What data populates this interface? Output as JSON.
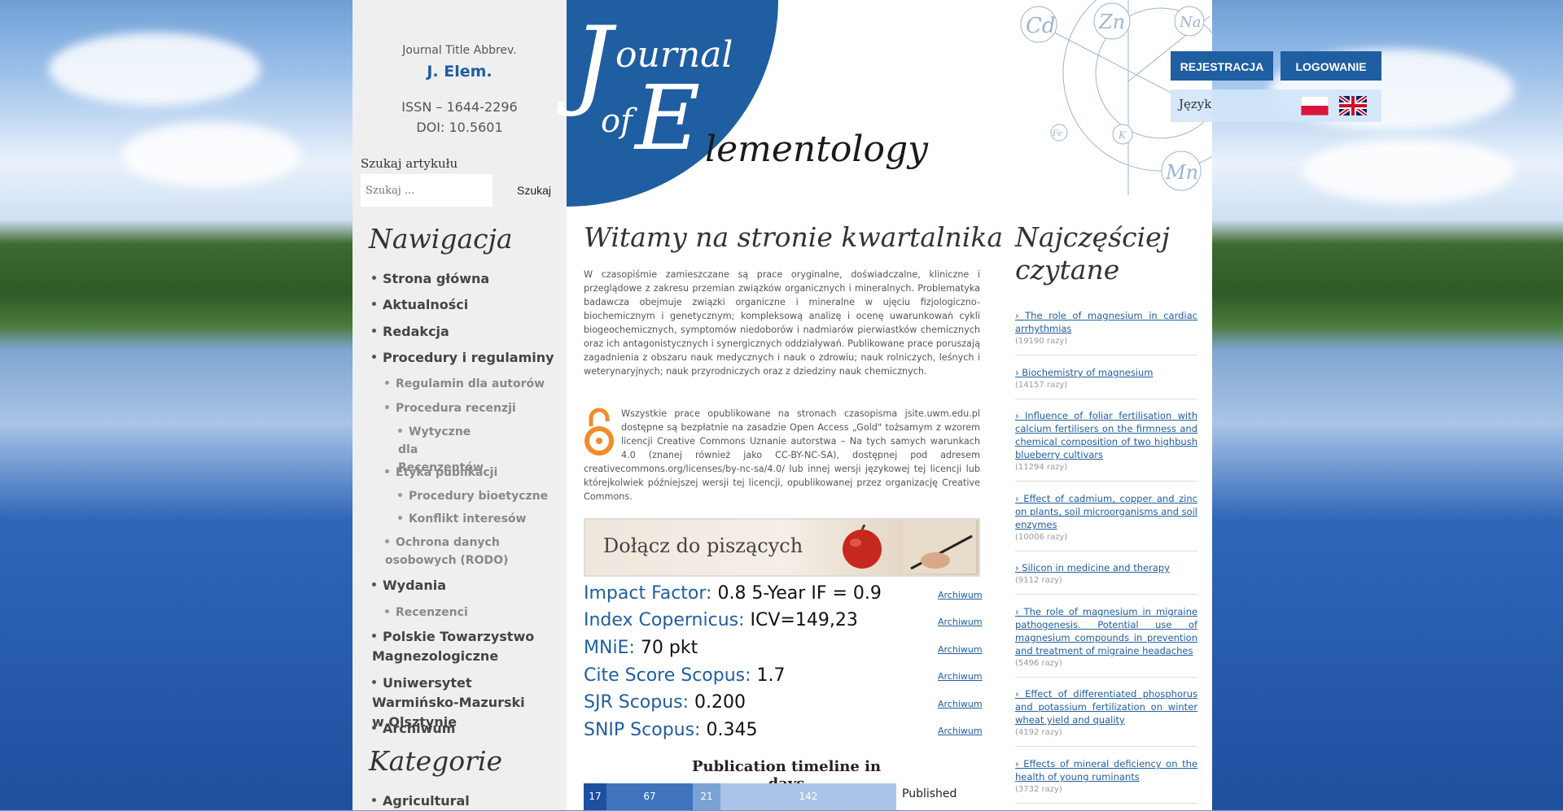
{
  "journal": {
    "abbr_label": "Journal Title Abbrev.",
    "abbr_value": "J. Elem.",
    "issn": "ISSN – 1644-2296",
    "doi": "DOI: 10.5601",
    "logo_text": "Journal of Elementology",
    "logo_J": "J",
    "logo_ournal": "ournal",
    "logo_of": "of",
    "logo_E": "E",
    "logo_lementology": "lementology"
  },
  "search": {
    "label": "Szukaj artykułu",
    "placeholder": "Szukaj ...",
    "button": "Szukaj"
  },
  "header": {
    "register": "REJESTRACJA",
    "login": "LOGOWANIE",
    "language_label": "Język",
    "elements": [
      "Cd",
      "Zn",
      "Na",
      "Fe",
      "K",
      "Mn"
    ]
  },
  "navigation": {
    "heading": "Nawigacja",
    "items": [
      {
        "label": "Strona główna"
      },
      {
        "label": "Aktualności"
      },
      {
        "label": "Redakcja"
      },
      {
        "label": "Procedury i regulaminy"
      },
      {
        "label": "Regulamin dla autorów"
      },
      {
        "label": "Procedura recenzji"
      },
      {
        "label": "Wytyczne dla Recenzentów"
      },
      {
        "label": "Etyka publikacji"
      },
      {
        "label": "Procedury bioetyczne"
      },
      {
        "label": "Konflikt interesów"
      },
      {
        "label": "Ochrona danych osobowych (RODO)"
      },
      {
        "label": "Wydania"
      },
      {
        "label": "Recenzenci"
      },
      {
        "label": "Polskie Towarzystwo Magnezologiczne"
      },
      {
        "label": "Uniwersytet Warmińsko-Mazurski w Olsztynie"
      },
      {
        "label": "Archiwum"
      }
    ]
  },
  "categories": {
    "heading": "Kategorie",
    "items": [
      {
        "label": "Agricultural"
      }
    ]
  },
  "main": {
    "welcome": "Witamy na stronie kwartalnika",
    "intro": "W czasopiśmie zamieszczane są prace oryginalne, doświadczalne, kliniczne i przeglądowe z zakresu przemian związków organicznych i mineralnych. Problematyka badawcza obejmuje związki organiczne i mineralne w ujęciu fizjologiczno-biochemicznym i genetycznym; kompleksową analizę i ocenę uwarunkowań cykli biogeochemicznych, symptomów niedoborów i nadmiarów pierwiastków chemicznych oraz ich antagonistycznych i synergicznych oddziaływań. Publikowane prace poruszają zagadnienia z obszaru nauk medycznych i nauk o zdrowiu; nauk rolniczych, leśnych i weterynaryjnych; nauk przyrodniczych oraz z dziedziny nauk chemicznych.",
    "open_access": "Wszystkie prace opublikowane na stronach czasopisma jsite.uwm.edu.pl dostępne są bezpłatnie na zasadzie Open Access „Gold\" tożsamym z wzorem licencji Creative Commons Uznanie autorstwa – Na tych samych warunkach 4.0 (znanej również jako CC-BY-NC-SA), dostępnej pod adresem creativecommons.org/licenses/by-nc-sa/4.0/ lub innej wersji językowej tej licencji lub którejkolwiek późniejszej wersji tej licencji, opublikowanej przez organizację Creative Commons.",
    "banner": "Dołącz do piszących",
    "metrics": [
      {
        "label": "Impact Factor:",
        "value": "0.8 5-Year IF = 0.9",
        "archive": "Archiwum"
      },
      {
        "label": "Index Copernicus:",
        "value": "ICV=149,23",
        "archive": "Archiwum"
      },
      {
        "label": "MNiE:",
        "value": "70 pkt",
        "archive": "Archiwum"
      },
      {
        "label": "Cite Score Scopus:",
        "value": "1.7",
        "archive": "Archiwum"
      },
      {
        "label": "SJR Scopus:",
        "value": "0.200",
        "archive": "Archiwum"
      },
      {
        "label": "SNIP Scopus:",
        "value": "0.345",
        "archive": "Archiwum"
      }
    ],
    "timeline": {
      "title": "Publication timeline in days",
      "segments": [
        {
          "value": "17",
          "color": "#1f4f9f"
        },
        {
          "value": "67",
          "color": "#3f74bd"
        },
        {
          "value": "21",
          "color": "#7aa2d4"
        },
        {
          "value": "142",
          "color": "#a9c4e6"
        }
      ],
      "label": "Published"
    }
  },
  "popular": {
    "heading": "Najczęściej czytane",
    "items": [
      {
        "title": "The role of magnesium in cardiac arrhythmias",
        "count": "(19190 razy)"
      },
      {
        "title": "Biochemistry of magnesium",
        "count": "(14157 razy)"
      },
      {
        "title": "Influence of foliar fertilisation with calcium fertilisers on the firmness and chemical composition of two highbush blueberry cultivars",
        "count": "(11294 razy)"
      },
      {
        "title": "Effect of cadmium, copper and zinc on plants, soil microorganisms and soil enzymes",
        "count": "(10006 razy)"
      },
      {
        "title": "Silicon in medicine and therapy",
        "count": "(9112 razy)"
      },
      {
        "title": "The role of magnesium in migraine pathogenesis. Potential use of magnesium compounds in prevention and treatment of migraine headaches",
        "count": "(5496 razy)"
      },
      {
        "title": "Effect of differentiated phosphorus and potassium fertilization on winter wheat yield and quality",
        "count": "(4192 razy)"
      },
      {
        "title": "Effects of mineral deficiency on the health of young ruminants",
        "count": "(3732 razy)"
      }
    ]
  }
}
